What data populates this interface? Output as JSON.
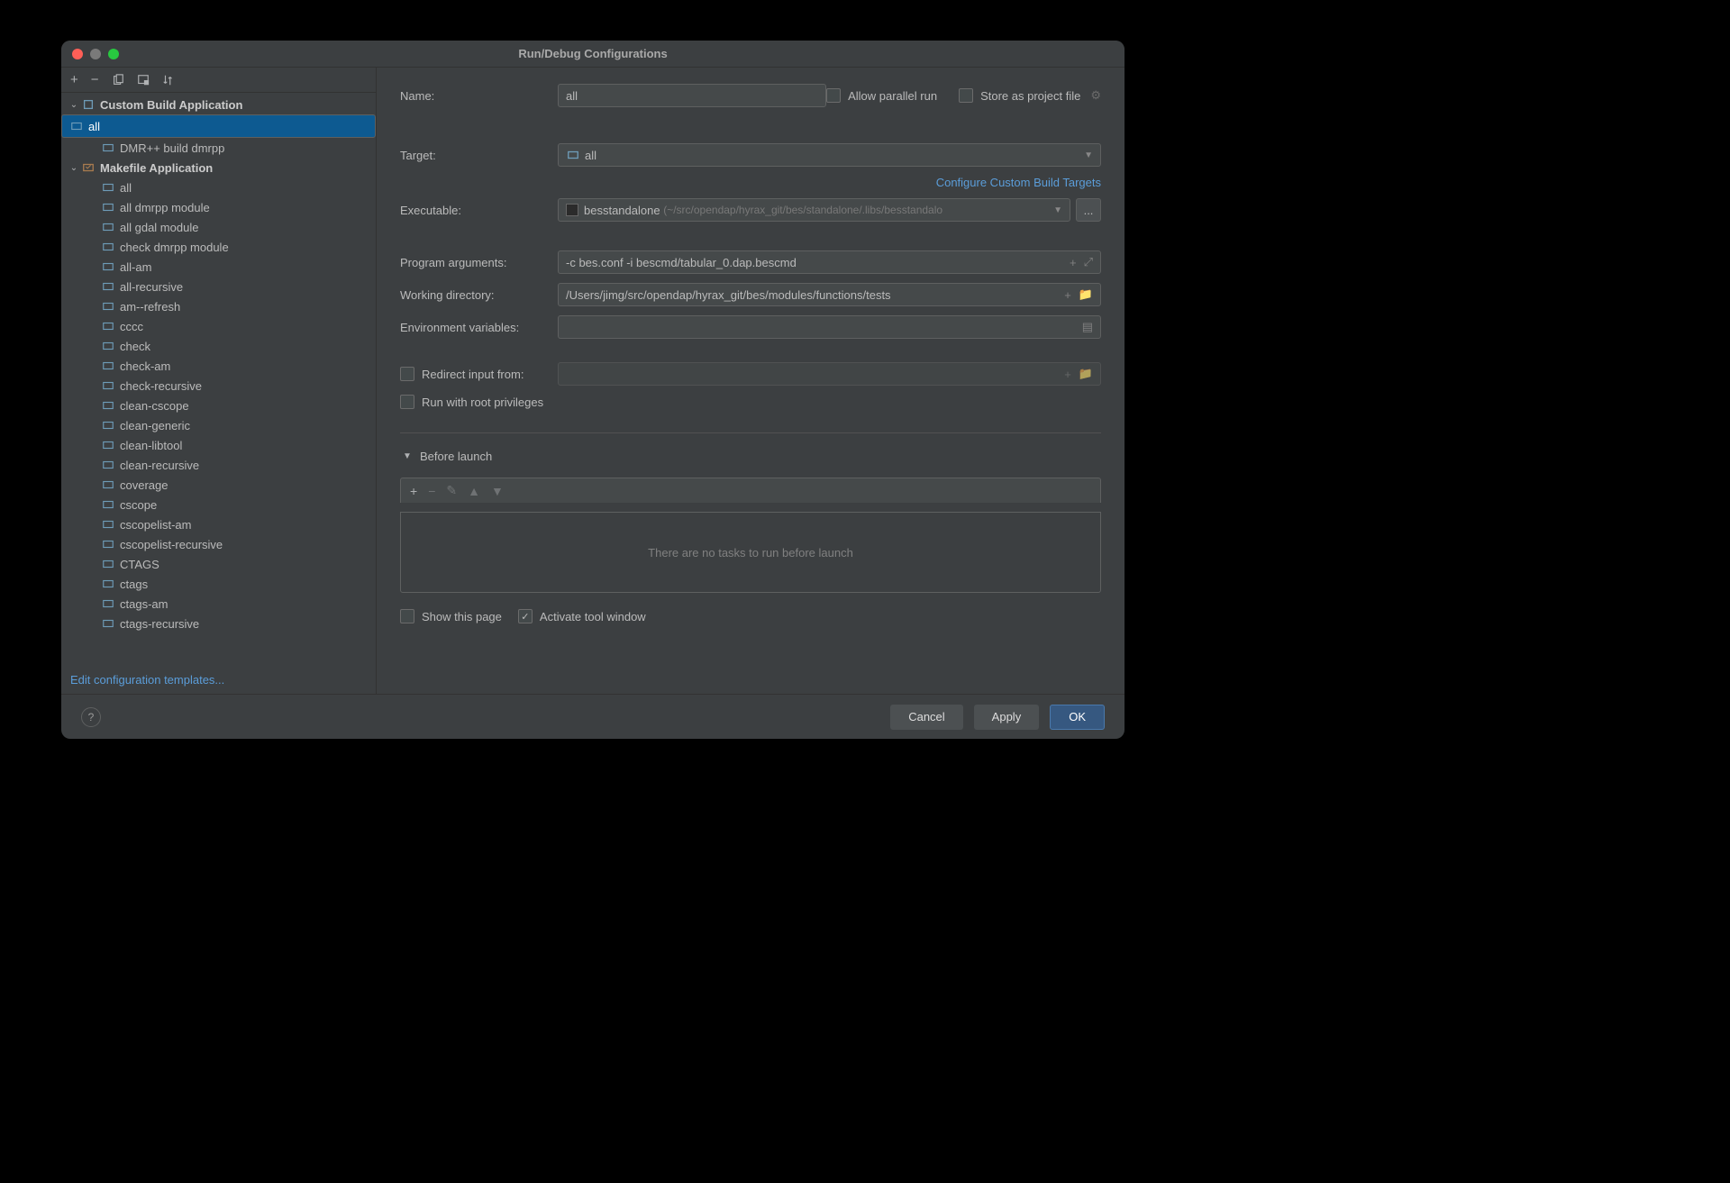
{
  "title": "Run/Debug Configurations",
  "ops": {
    "add": "+",
    "remove": "−"
  },
  "tree": {
    "groups": [
      {
        "label": "Custom Build Application",
        "icon": "cube",
        "items": [
          {
            "label": "all",
            "selected": true
          },
          {
            "label": "DMR++ build dmrpp"
          }
        ]
      },
      {
        "label": "Makefile Application",
        "icon": "make",
        "items": [
          {
            "label": "all"
          },
          {
            "label": "all dmrpp module"
          },
          {
            "label": "all gdal module"
          },
          {
            "label": "check dmrpp module"
          },
          {
            "label": "all-am"
          },
          {
            "label": "all-recursive"
          },
          {
            "label": "am--refresh"
          },
          {
            "label": "cccc"
          },
          {
            "label": "check"
          },
          {
            "label": "check-am"
          },
          {
            "label": "check-recursive"
          },
          {
            "label": "clean-cscope"
          },
          {
            "label": "clean-generic"
          },
          {
            "label": "clean-libtool"
          },
          {
            "label": "clean-recursive"
          },
          {
            "label": "coverage"
          },
          {
            "label": "cscope"
          },
          {
            "label": "cscopelist-am"
          },
          {
            "label": "cscopelist-recursive"
          },
          {
            "label": "CTAGS"
          },
          {
            "label": "ctags"
          },
          {
            "label": "ctags-am"
          },
          {
            "label": "ctags-recursive"
          }
        ]
      }
    ]
  },
  "ect": "Edit configuration templates...",
  "form": {
    "name_label": "Name:",
    "name": "all",
    "allow_parallel": "Allow parallel run",
    "store": "Store as project file",
    "target_label": "Target:",
    "target": "all",
    "config_link": "Configure Custom Build Targets",
    "exec_label": "Executable:",
    "exec_name": "besstandalone",
    "exec_path": "(~/src/opendap/hyrax_git/bes/standalone/.libs/besstandalo",
    "args_label": "Program arguments:",
    "args": "-c bes.conf -i bescmd/tabular_0.dap.bescmd",
    "wd_label": "Working directory:",
    "wd": "/Users/jimg/src/opendap/hyrax_git/bes/modules/functions/tests",
    "env_label": "Environment variables:",
    "env": "",
    "redir": "Redirect input from:",
    "root": "Run with root privileges",
    "before": "Before launch",
    "notasks": "There are no tasks to run before launch",
    "showpage": "Show this page",
    "activate": "Activate tool window"
  },
  "buttons": {
    "cancel": "Cancel",
    "apply": "Apply",
    "ok": "OK",
    "dots": "..."
  }
}
